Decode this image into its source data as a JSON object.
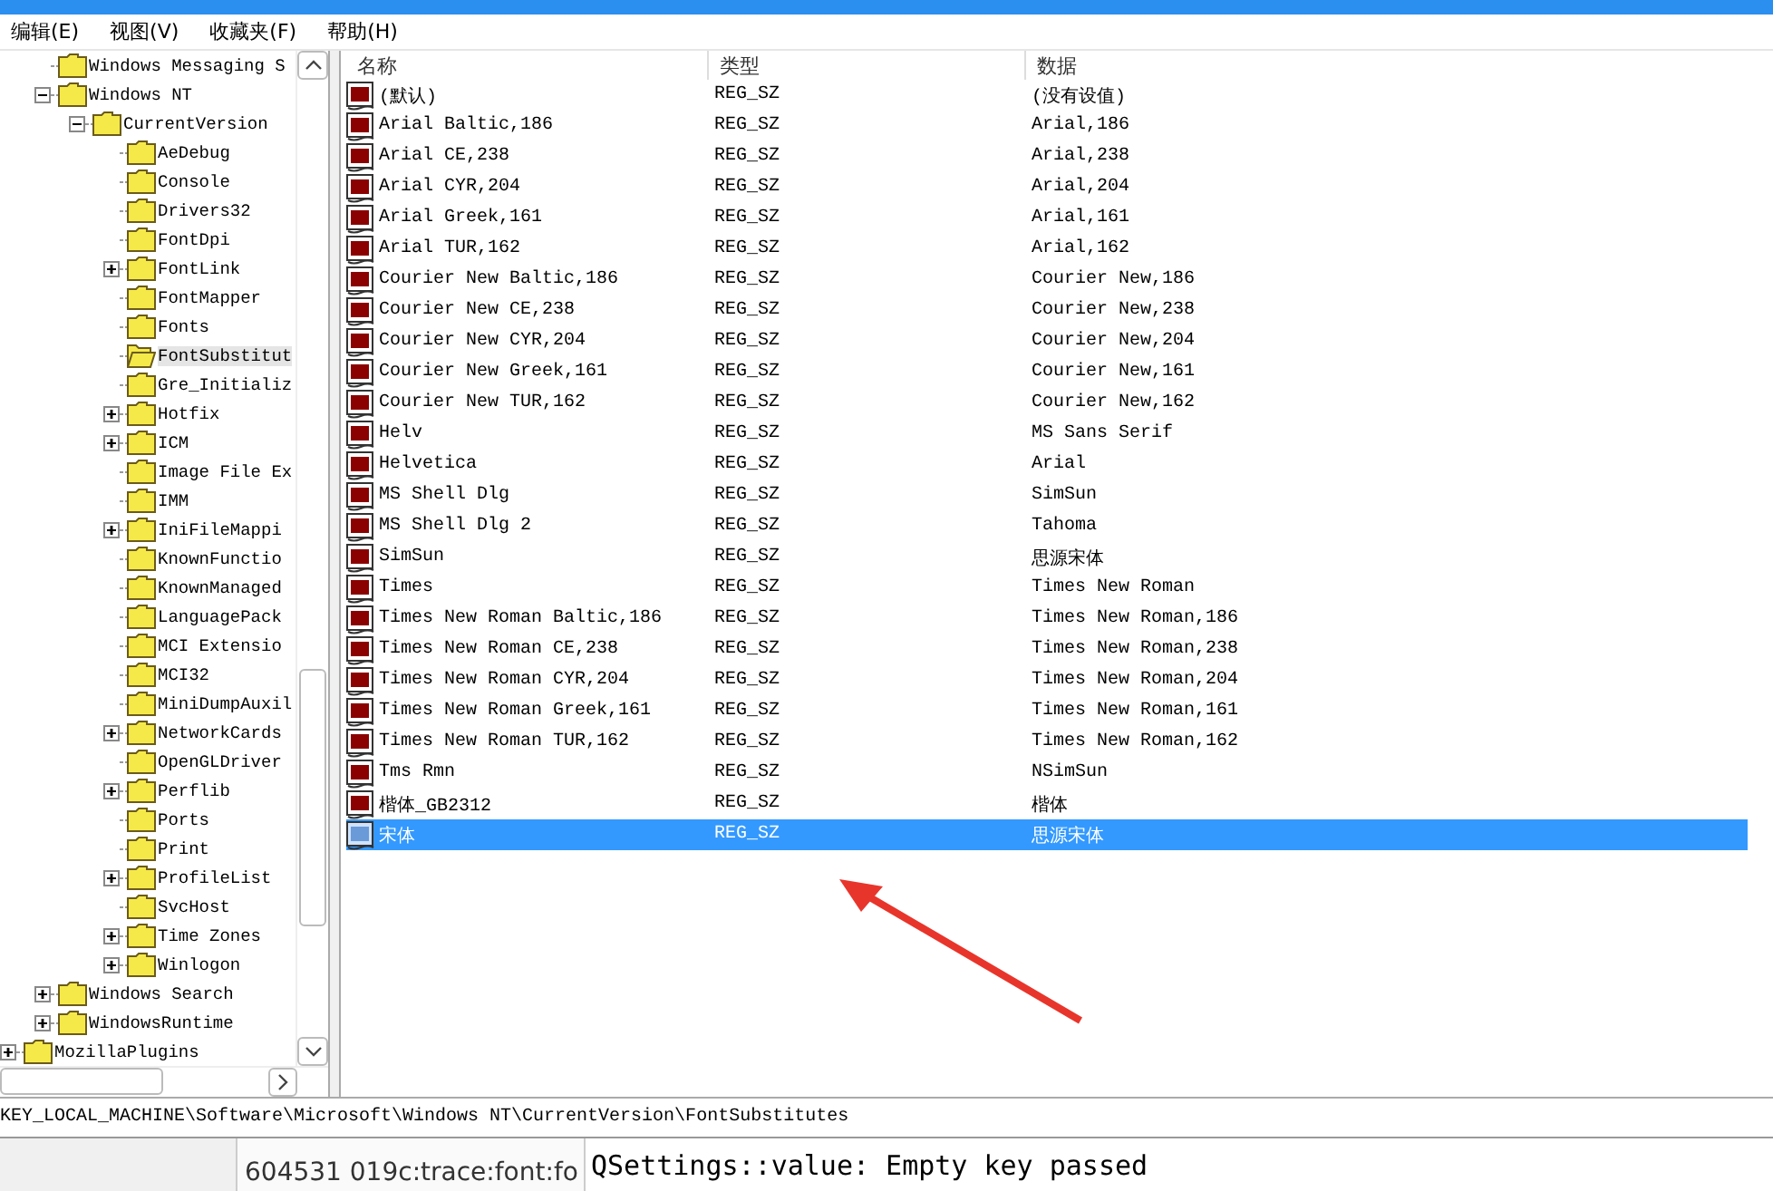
{
  "menu": [
    {
      "label": "编辑(E)"
    },
    {
      "label": "视图(V)"
    },
    {
      "label": "收藏夹(F)"
    },
    {
      "label": "帮助(H)"
    }
  ],
  "tree": {
    "items": [
      {
        "children": [
          {
            "label": "Windows Messaging S",
            "selected": false
          },
          {
            "label": "Windows NT",
            "expanded": true,
            "selected": false,
            "children": [
              {
                "label": "CurrentVersion",
                "expanded": true,
                "selected": false,
                "children": [
                  {
                    "label": "AeDebug",
                    "selected": false
                  },
                  {
                    "label": "Console",
                    "selected": false
                  },
                  {
                    "label": "Drivers32",
                    "selected": false
                  },
                  {
                    "label": "FontDpi",
                    "selected": false
                  },
                  {
                    "label": "FontLink",
                    "expanded": false,
                    "selected": false
                  },
                  {
                    "label": "FontMapper",
                    "selected": false
                  },
                  {
                    "label": "Fonts",
                    "selected": false
                  },
                  {
                    "label": "FontSubstitut",
                    "selected": true
                  },
                  {
                    "label": "Gre_Initializ",
                    "selected": false
                  },
                  {
                    "label": "Hotfix",
                    "expanded": false,
                    "selected": false
                  },
                  {
                    "label": "ICM",
                    "expanded": false,
                    "selected": false
                  },
                  {
                    "label": "Image File Ex",
                    "selected": false
                  },
                  {
                    "label": "IMM",
                    "selected": false
                  },
                  {
                    "label": "IniFileMappi",
                    "expanded": false,
                    "selected": false
                  },
                  {
                    "label": "KnownFunctio",
                    "selected": false
                  },
                  {
                    "label": "KnownManaged",
                    "selected": false
                  },
                  {
                    "label": "LanguagePack",
                    "selected": false
                  },
                  {
                    "label": "MCI Extensio",
                    "selected": false
                  },
                  {
                    "label": "MCI32",
                    "selected": false
                  },
                  {
                    "label": "MiniDumpAuxil",
                    "selected": false
                  },
                  {
                    "label": "NetworkCards",
                    "expanded": false,
                    "selected": false
                  },
                  {
                    "label": "OpenGLDriver",
                    "selected": false
                  },
                  {
                    "label": "Perflib",
                    "expanded": false,
                    "selected": false
                  },
                  {
                    "label": "Ports",
                    "selected": false
                  },
                  {
                    "label": "Print",
                    "selected": false
                  },
                  {
                    "label": "ProfileList",
                    "expanded": false,
                    "selected": false
                  },
                  {
                    "label": "SvcHost",
                    "selected": false
                  },
                  {
                    "label": "Time Zones",
                    "expanded": false,
                    "selected": false
                  },
                  {
                    "label": "Winlogon",
                    "expanded": false,
                    "selected": false
                  }
                ]
              }
            ]
          },
          {
            "label": "Windows Search",
            "expanded": false,
            "selected": false
          },
          {
            "label": "WindowsRuntime",
            "expanded": false,
            "selected": false
          }
        ]
      },
      {
        "label": "MozillaPlugins",
        "expanded": false,
        "selected": false
      }
    ]
  },
  "table": {
    "columns": [
      "名称",
      "类型",
      "数据"
    ],
    "rows": [
      {
        "name": "(默认)",
        "type": "REG_SZ",
        "data": "(没有设值)",
        "selected": false
      },
      {
        "name": "Arial Baltic,186",
        "type": "REG_SZ",
        "data": "Arial,186",
        "selected": false
      },
      {
        "name": "Arial CE,238",
        "type": "REG_SZ",
        "data": "Arial,238",
        "selected": false
      },
      {
        "name": "Arial CYR,204",
        "type": "REG_SZ",
        "data": "Arial,204",
        "selected": false
      },
      {
        "name": "Arial Greek,161",
        "type": "REG_SZ",
        "data": "Arial,161",
        "selected": false
      },
      {
        "name": "Arial TUR,162",
        "type": "REG_SZ",
        "data": "Arial,162",
        "selected": false
      },
      {
        "name": "Courier New Baltic,186",
        "type": "REG_SZ",
        "data": "Courier New,186",
        "selected": false
      },
      {
        "name": "Courier New CE,238",
        "type": "REG_SZ",
        "data": "Courier New,238",
        "selected": false
      },
      {
        "name": "Courier New CYR,204",
        "type": "REG_SZ",
        "data": "Courier New,204",
        "selected": false
      },
      {
        "name": "Courier New Greek,161",
        "type": "REG_SZ",
        "data": "Courier New,161",
        "selected": false
      },
      {
        "name": "Courier New TUR,162",
        "type": "REG_SZ",
        "data": "Courier New,162",
        "selected": false
      },
      {
        "name": "Helv",
        "type": "REG_SZ",
        "data": "MS Sans Serif",
        "selected": false
      },
      {
        "name": "Helvetica",
        "type": "REG_SZ",
        "data": "Arial",
        "selected": false
      },
      {
        "name": "MS Shell Dlg",
        "type": "REG_SZ",
        "data": "SimSun",
        "selected": false
      },
      {
        "name": "MS Shell Dlg 2",
        "type": "REG_SZ",
        "data": "Tahoma",
        "selected": false
      },
      {
        "name": "SimSun",
        "type": "REG_SZ",
        "data": "思源宋体",
        "selected": false
      },
      {
        "name": "Times",
        "type": "REG_SZ",
        "data": "Times New Roman",
        "selected": false
      },
      {
        "name": "Times New Roman Baltic,186",
        "type": "REG_SZ",
        "data": "Times New Roman,186",
        "selected": false
      },
      {
        "name": "Times New Roman CE,238",
        "type": "REG_SZ",
        "data": "Times New Roman,238",
        "selected": false
      },
      {
        "name": "Times New Roman CYR,204",
        "type": "REG_SZ",
        "data": "Times New Roman,204",
        "selected": false
      },
      {
        "name": "Times New Roman Greek,161",
        "type": "REG_SZ",
        "data": "Times New Roman,161",
        "selected": false
      },
      {
        "name": "Times New Roman TUR,162",
        "type": "REG_SZ",
        "data": "Times New Roman,162",
        "selected": false
      },
      {
        "name": "Tms Rmn",
        "type": "REG_SZ",
        "data": "NSimSun",
        "selected": false
      },
      {
        "name": "楷体_GB2312",
        "type": "REG_SZ",
        "data": "楷体",
        "selected": false
      },
      {
        "name": "宋体",
        "type": "REG_SZ",
        "data": "思源宋体",
        "selected": true
      }
    ]
  },
  "status_bar": {
    "path": "KEY_LOCAL_MACHINE\\Software\\Microsoft\\Windows NT\\CurrentVersion\\FontSubstitutes"
  },
  "background_window": {
    "log_line": "604531 019c:trace:font:fo",
    "message": "QSettings::value: Empty key passed"
  }
}
